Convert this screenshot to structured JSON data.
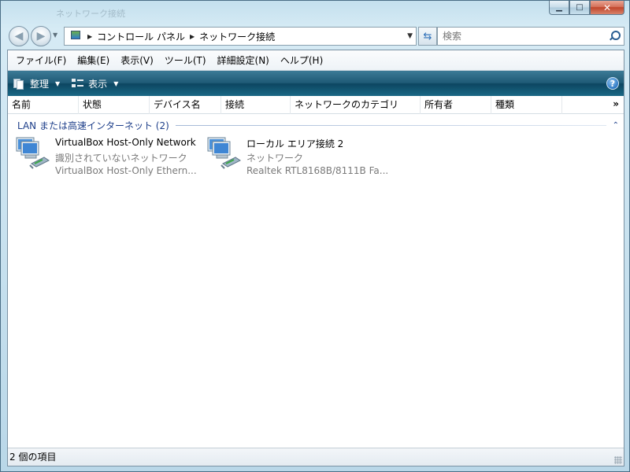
{
  "window": {
    "ghost_title": "ネットワーク接続"
  },
  "caption": {
    "minimize": "▁",
    "maximize": "□",
    "close": "✕"
  },
  "nav": {
    "breadcrumbs": [
      "コントロール パネル",
      "ネットワーク接続"
    ],
    "search_placeholder": "検索"
  },
  "menu": {
    "items": [
      "ファイル(F)",
      "編集(E)",
      "表示(V)",
      "ツール(T)",
      "詳細設定(N)",
      "ヘルプ(H)"
    ]
  },
  "commandbar": {
    "organize": "整理",
    "views": "表示",
    "help": "?"
  },
  "columns": [
    "名前",
    "状態",
    "デバイス名",
    "接続",
    "ネットワークのカテゴリ",
    "所有者",
    "種類"
  ],
  "columns_more": "»",
  "group": {
    "title": "LAN または高速インターネット (2)",
    "collapse": "⌃"
  },
  "items": [
    {
      "name": "VirtualBox Host-Only Network",
      "status": "識別されていないネットワーク",
      "device": "VirtualBox Host-Only Ethern...",
      "icon": "network-adapter-icon"
    },
    {
      "name": "ローカル エリア接続 2",
      "status": "ネットワーク",
      "device": "Realtek RTL8168B/8111B Fa...",
      "icon": "network-adapter-icon"
    }
  ],
  "status": {
    "text": "2 個の項目"
  },
  "colors": {
    "command_bar": "#1f5a76",
    "group_title": "#1e3f8a",
    "secondary_text": "#7a7a7a"
  }
}
